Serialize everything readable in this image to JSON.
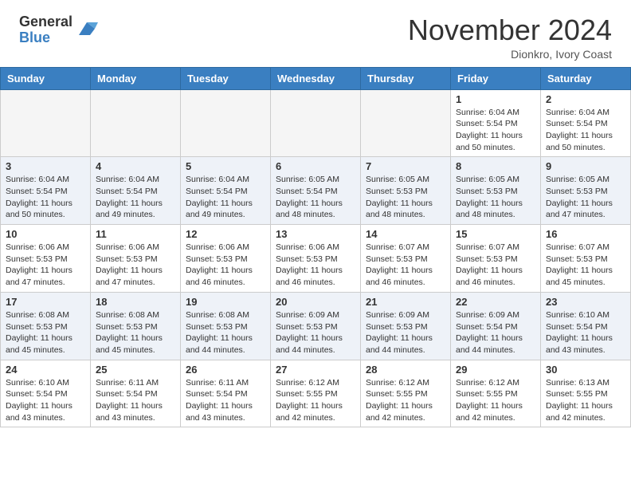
{
  "header": {
    "logo_line1": "General",
    "logo_line2": "Blue",
    "month_title": "November 2024",
    "location": "Dionkro, Ivory Coast"
  },
  "weekdays": [
    "Sunday",
    "Monday",
    "Tuesday",
    "Wednesday",
    "Thursday",
    "Friday",
    "Saturday"
  ],
  "weeks": [
    [
      {
        "day": "",
        "info": ""
      },
      {
        "day": "",
        "info": ""
      },
      {
        "day": "",
        "info": ""
      },
      {
        "day": "",
        "info": ""
      },
      {
        "day": "",
        "info": ""
      },
      {
        "day": "1",
        "info": "Sunrise: 6:04 AM\nSunset: 5:54 PM\nDaylight: 11 hours\nand 50 minutes."
      },
      {
        "day": "2",
        "info": "Sunrise: 6:04 AM\nSunset: 5:54 PM\nDaylight: 11 hours\nand 50 minutes."
      }
    ],
    [
      {
        "day": "3",
        "info": "Sunrise: 6:04 AM\nSunset: 5:54 PM\nDaylight: 11 hours\nand 50 minutes."
      },
      {
        "day": "4",
        "info": "Sunrise: 6:04 AM\nSunset: 5:54 PM\nDaylight: 11 hours\nand 49 minutes."
      },
      {
        "day": "5",
        "info": "Sunrise: 6:04 AM\nSunset: 5:54 PM\nDaylight: 11 hours\nand 49 minutes."
      },
      {
        "day": "6",
        "info": "Sunrise: 6:05 AM\nSunset: 5:54 PM\nDaylight: 11 hours\nand 48 minutes."
      },
      {
        "day": "7",
        "info": "Sunrise: 6:05 AM\nSunset: 5:53 PM\nDaylight: 11 hours\nand 48 minutes."
      },
      {
        "day": "8",
        "info": "Sunrise: 6:05 AM\nSunset: 5:53 PM\nDaylight: 11 hours\nand 48 minutes."
      },
      {
        "day": "9",
        "info": "Sunrise: 6:05 AM\nSunset: 5:53 PM\nDaylight: 11 hours\nand 47 minutes."
      }
    ],
    [
      {
        "day": "10",
        "info": "Sunrise: 6:06 AM\nSunset: 5:53 PM\nDaylight: 11 hours\nand 47 minutes."
      },
      {
        "day": "11",
        "info": "Sunrise: 6:06 AM\nSunset: 5:53 PM\nDaylight: 11 hours\nand 47 minutes."
      },
      {
        "day": "12",
        "info": "Sunrise: 6:06 AM\nSunset: 5:53 PM\nDaylight: 11 hours\nand 46 minutes."
      },
      {
        "day": "13",
        "info": "Sunrise: 6:06 AM\nSunset: 5:53 PM\nDaylight: 11 hours\nand 46 minutes."
      },
      {
        "day": "14",
        "info": "Sunrise: 6:07 AM\nSunset: 5:53 PM\nDaylight: 11 hours\nand 46 minutes."
      },
      {
        "day": "15",
        "info": "Sunrise: 6:07 AM\nSunset: 5:53 PM\nDaylight: 11 hours\nand 46 minutes."
      },
      {
        "day": "16",
        "info": "Sunrise: 6:07 AM\nSunset: 5:53 PM\nDaylight: 11 hours\nand 45 minutes."
      }
    ],
    [
      {
        "day": "17",
        "info": "Sunrise: 6:08 AM\nSunset: 5:53 PM\nDaylight: 11 hours\nand 45 minutes."
      },
      {
        "day": "18",
        "info": "Sunrise: 6:08 AM\nSunset: 5:53 PM\nDaylight: 11 hours\nand 45 minutes."
      },
      {
        "day": "19",
        "info": "Sunrise: 6:08 AM\nSunset: 5:53 PM\nDaylight: 11 hours\nand 44 minutes."
      },
      {
        "day": "20",
        "info": "Sunrise: 6:09 AM\nSunset: 5:53 PM\nDaylight: 11 hours\nand 44 minutes."
      },
      {
        "day": "21",
        "info": "Sunrise: 6:09 AM\nSunset: 5:53 PM\nDaylight: 11 hours\nand 44 minutes."
      },
      {
        "day": "22",
        "info": "Sunrise: 6:09 AM\nSunset: 5:54 PM\nDaylight: 11 hours\nand 44 minutes."
      },
      {
        "day": "23",
        "info": "Sunrise: 6:10 AM\nSunset: 5:54 PM\nDaylight: 11 hours\nand 43 minutes."
      }
    ],
    [
      {
        "day": "24",
        "info": "Sunrise: 6:10 AM\nSunset: 5:54 PM\nDaylight: 11 hours\nand 43 minutes."
      },
      {
        "day": "25",
        "info": "Sunrise: 6:11 AM\nSunset: 5:54 PM\nDaylight: 11 hours\nand 43 minutes."
      },
      {
        "day": "26",
        "info": "Sunrise: 6:11 AM\nSunset: 5:54 PM\nDaylight: 11 hours\nand 43 minutes."
      },
      {
        "day": "27",
        "info": "Sunrise: 6:12 AM\nSunset: 5:55 PM\nDaylight: 11 hours\nand 42 minutes."
      },
      {
        "day": "28",
        "info": "Sunrise: 6:12 AM\nSunset: 5:55 PM\nDaylight: 11 hours\nand 42 minutes."
      },
      {
        "day": "29",
        "info": "Sunrise: 6:12 AM\nSunset: 5:55 PM\nDaylight: 11 hours\nand 42 minutes."
      },
      {
        "day": "30",
        "info": "Sunrise: 6:13 AM\nSunset: 5:55 PM\nDaylight: 11 hours\nand 42 minutes."
      }
    ]
  ]
}
